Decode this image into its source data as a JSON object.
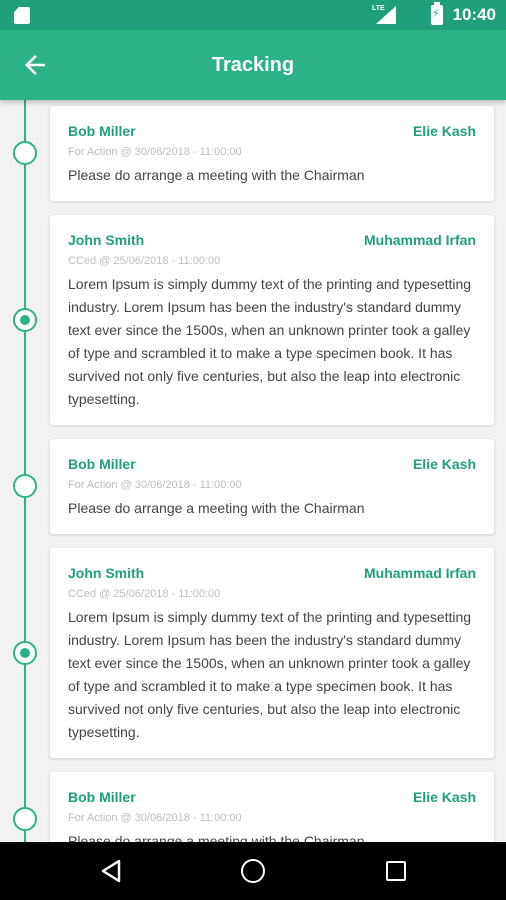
{
  "status_bar": {
    "network_label": "LTE",
    "time": "10:40",
    "icons": [
      "sd-card-icon",
      "signal-icon",
      "battery-charging-icon"
    ]
  },
  "app_bar": {
    "title": "Tracking",
    "back_icon": "arrow-back-icon"
  },
  "accent_color": "#2bb387",
  "entries": [
    {
      "from": "Bob Miller",
      "to": "Elie Kash",
      "meta": "For Action @ 30/06/2018 - 11:00:00",
      "message": "Please do arrange a meeting with the Chairman",
      "node": "hollow"
    },
    {
      "from": "John Smith",
      "to": "Muhammad Irfan",
      "meta": "CCed @ 25/06/2018 - 11:00:00",
      "message": "Lorem Ipsum is simply dummy text of the printing and typesetting industry. Lorem Ipsum has been the industry's standard dummy text ever since the 1500s, when an unknown printer took a galley of type and scrambled it to make a type specimen book. It has survived not only five centuries, but also the leap into electronic typesetting.",
      "node": "filled"
    },
    {
      "from": "Bob Miller",
      "to": "Elie Kash",
      "meta": "For Action @ 30/06/2018 - 11:00:00",
      "message": "Please do arrange a meeting with the Chairman",
      "node": "hollow"
    },
    {
      "from": "John Smith",
      "to": "Muhammad Irfan",
      "meta": "CCed @ 25/06/2018 - 11:00:00",
      "message": "Lorem Ipsum is simply dummy text of the printing and typesetting industry. Lorem Ipsum has been the industry's standard dummy text ever since the 1500s, when an unknown printer took a galley of type and scrambled it to make a type specimen book. It has survived not only five centuries, but also the leap into electronic typesetting.",
      "node": "filled"
    },
    {
      "from": "Bob Miller",
      "to": "Elie Kash",
      "meta": "For Action @ 30/06/2018 - 11:00:00",
      "message": "Please do arrange a meeting with the Chairman",
      "node": "hollow"
    }
  ],
  "nav_bar": {
    "icons": [
      "nav-back-icon",
      "nav-home-icon",
      "nav-recents-icon"
    ]
  }
}
